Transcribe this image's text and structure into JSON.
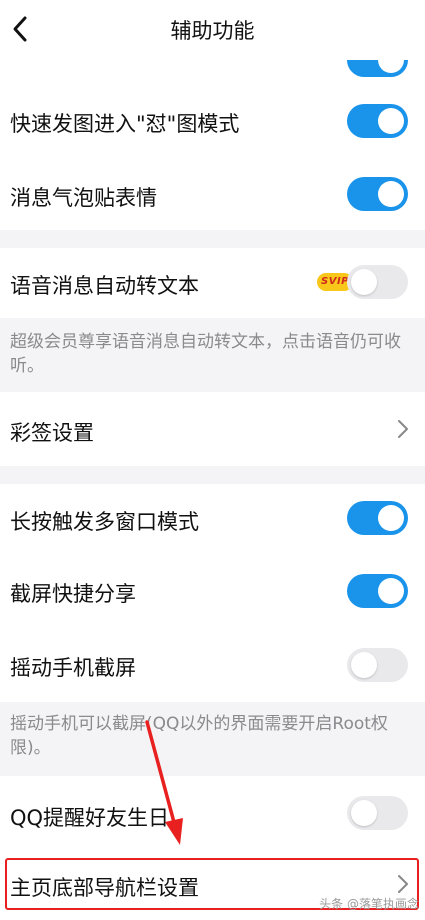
{
  "header": {
    "title": "辅助功能"
  },
  "rows": {
    "quick_image": {
      "label": "快速发图进入\"怼\"图模式",
      "state": "on"
    },
    "bubble_sticker": {
      "label": "消息气泡贴表情",
      "state": "on"
    },
    "voice_to_text": {
      "label": "语音消息自动转文本",
      "badge": "SVIP",
      "state": "off"
    },
    "voice_desc": "超级会员尊享语音消息自动转文本，点击语音仍可收听。",
    "caiqian": {
      "label": "彩签设置"
    },
    "long_press": {
      "label": "长按触发多窗口模式",
      "state": "on"
    },
    "screenshot_share": {
      "label": "截屏快捷分享",
      "state": "on"
    },
    "shake_screenshot": {
      "label": "摇动手机截屏",
      "state": "off"
    },
    "shake_desc": "摇动手机可以截屏(QQ以外的界面需要开启Root权限)。",
    "birthday": {
      "label": "QQ提醒好友生日",
      "state": "off"
    },
    "bottom_nav": {
      "label": "主页底部导航栏设置"
    }
  },
  "watermark": "头条 @落笔执画念",
  "colors": {
    "toggle_on": "#1a93ea",
    "toggle_off": "#e9e9ec",
    "highlight": "#e82020",
    "svip_bg": "#f9c61a"
  }
}
